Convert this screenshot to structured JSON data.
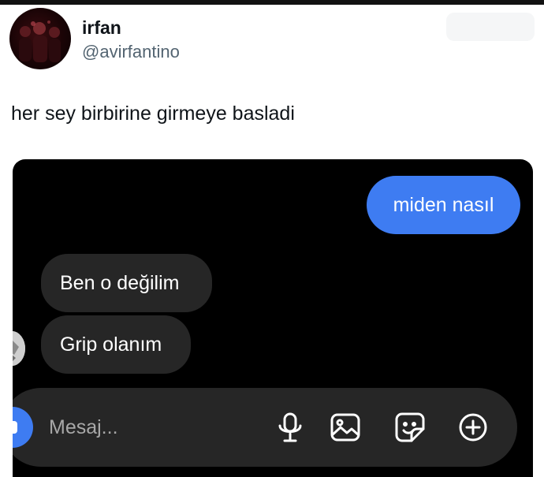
{
  "tweet": {
    "author_name": "irfan",
    "author_handle": "@avirfantino",
    "text": "her sey birbirine girmeye basladi"
  },
  "chat": {
    "messages": [
      {
        "direction": "outgoing",
        "text": "miden nasıl"
      },
      {
        "direction": "incoming",
        "text": "Ben o değilim"
      },
      {
        "direction": "incoming",
        "text": "Grip olanım"
      }
    ],
    "composer": {
      "placeholder": "Mesaj...",
      "icons": [
        "camera-icon",
        "microphone-icon",
        "gallery-icon",
        "sticker-icon",
        "plus-icon"
      ]
    },
    "colors": {
      "background": "#000000",
      "outgoing_bubble": "#3e7cf2",
      "incoming_bubble": "#262626",
      "composer": "#262626"
    }
  }
}
